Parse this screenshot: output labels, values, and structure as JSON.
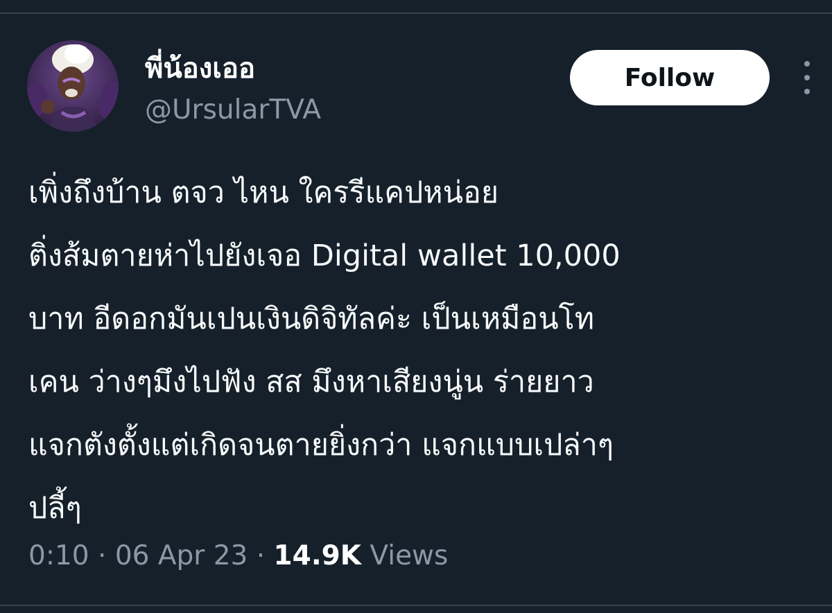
{
  "author": {
    "display_name": "พี่น้องเออ",
    "handle": "@UrsularTVA",
    "avatar_icon": "profile-photo"
  },
  "actions": {
    "follow_label": "Follow",
    "more_icon": "more-vertical-icon"
  },
  "tweet": {
    "lines": [
      "เพิ่งถึงบ้าน ตจว ไหน ใครรีแคปหน่อย",
      "ติ่งส้มตายห่าไปยังเจอ Digital wallet 10,000",
      "บาท อีดอกมันเปนเงินดิจิทัลค่ะ เป็นเหมือนโท",
      "เคน ว่างๆมึงไปฟัง สส มึงหาเสียงนู่น ร่ายยาว",
      "แจกตังตั้งแต่เกิดจนตายยิ่งกว่า แจกแบบเปล่าๆ",
      "ปลี้ๆ"
    ]
  },
  "meta": {
    "time": "0:10",
    "separator": "·",
    "date": "06 Apr 23",
    "views_count": "14.9K",
    "views_label": "Views"
  },
  "colors": {
    "background": "#15202b",
    "divider": "#38444d",
    "primary_text": "#ffffff",
    "secondary_text": "#8b98a5",
    "follow_bg": "#ffffff",
    "follow_text": "#0f1419"
  }
}
